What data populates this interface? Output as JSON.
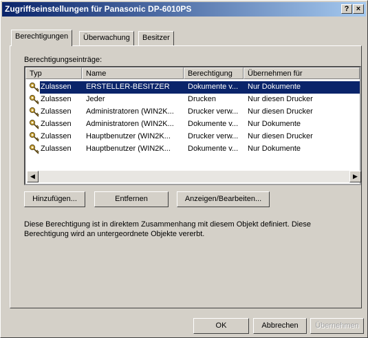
{
  "window": {
    "title": "Zugriffseinstellungen für Panasonic DP-6010PS",
    "help_button": "?",
    "close_button": "×"
  },
  "tabs": [
    {
      "label": "Berechtigungen",
      "active": true
    },
    {
      "label": "Überwachung",
      "active": false
    },
    {
      "label": "Besitzer",
      "active": false
    }
  ],
  "permissions": {
    "group_label": "Berechtigungseinträge:",
    "columns": [
      "Typ",
      "Name",
      "Berechtigung",
      "Übernehmen für"
    ],
    "rows": [
      {
        "type": "Zulassen",
        "name": "ERSTELLER-BESITZER",
        "permission": "Dokumente v...",
        "apply_to": "Nur Dokumente",
        "selected": true
      },
      {
        "type": "Zulassen",
        "name": "Jeder",
        "permission": "Drucken",
        "apply_to": "Nur diesen Drucker"
      },
      {
        "type": "Zulassen",
        "name": "Administratoren (WIN2K...",
        "permission": "Drucker verw...",
        "apply_to": "Nur diesen Drucker"
      },
      {
        "type": "Zulassen",
        "name": "Administratoren (WIN2K...",
        "permission": "Dokumente v...",
        "apply_to": "Nur Dokumente"
      },
      {
        "type": "Zulassen",
        "name": "Hauptbenutzer (WIN2K...",
        "permission": "Drucker verw...",
        "apply_to": "Nur diesen Drucker"
      },
      {
        "type": "Zulassen",
        "name": "Hauptbenutzer (WIN2K...",
        "permission": "Dokumente v...",
        "apply_to": "Nur Dokumente"
      }
    ],
    "icon": "key-icon"
  },
  "buttons": {
    "add": "Hinzufügen...",
    "remove": "Entfernen",
    "view_edit": "Anzeigen/Bearbeiten...",
    "ok": "OK",
    "cancel": "Abbrechen",
    "apply": "Übernehmen"
  },
  "description": "Diese Berechtigung ist in direktem Zusammenhang mit diesem Objekt definiert. Diese Berechtigung wird an untergeordnete Objekte vererbt.",
  "colors": {
    "selection": "#0a246a",
    "titlebar_start": "#0a246a",
    "titlebar_end": "#a6caf0"
  }
}
